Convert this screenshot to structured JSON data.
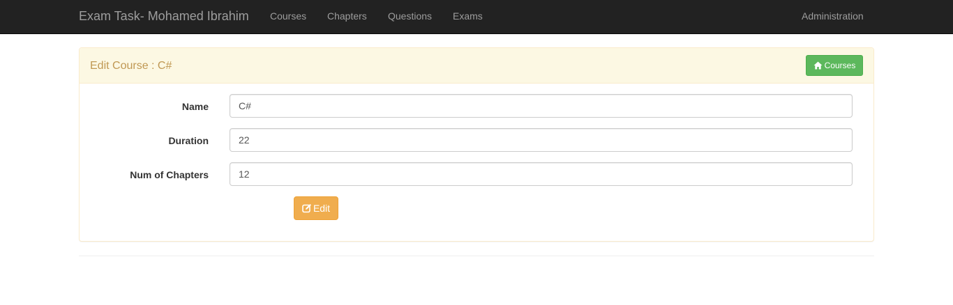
{
  "navbar": {
    "brand": "Exam Task- Mohamed Ibrahim",
    "links": [
      "Courses",
      "Chapters",
      "Questions",
      "Exams"
    ],
    "right_link": "Administration"
  },
  "panel": {
    "title": "Edit Course : C#",
    "back_button": {
      "label": "Courses",
      "icon": "home-icon"
    }
  },
  "form": {
    "fields": [
      {
        "label": "Name",
        "value": "C#"
      },
      {
        "label": "Duration",
        "value": "22"
      },
      {
        "label": "Num of Chapters",
        "value": "12"
      }
    ],
    "submit": {
      "label": "Edit",
      "icon": "edit-icon"
    }
  },
  "colors": {
    "navbar_bg": "#222222",
    "panel_heading_bg": "#fcf8e3",
    "panel_title": "#c09853",
    "success": "#5cb85c",
    "warning": "#f0ad4e"
  }
}
